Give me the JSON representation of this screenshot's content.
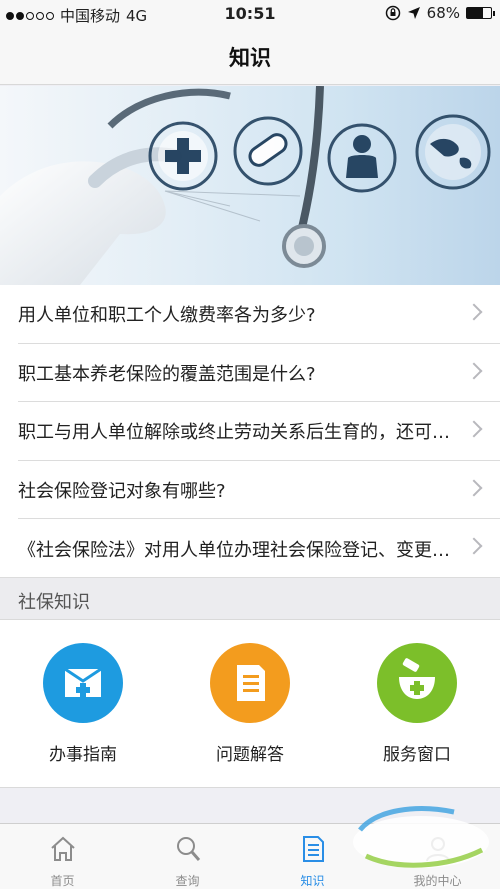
{
  "status_bar": {
    "carrier": "中国移动",
    "network": "4G",
    "time": "10:51",
    "battery": "68%",
    "battery_level": 0.68
  },
  "nav": {
    "title": "知识"
  },
  "faq": [
    {
      "text": "用人单位和职工个人缴费率各为多少?"
    },
    {
      "text": "职工基本养老保险的覆盖范围是什么?"
    },
    {
      "text": "职工与用人单位解除或终止劳动关系后生育的，还可以享受生育保险待遇吗?"
    },
    {
      "text": "社会保险登记对象有哪些?"
    },
    {
      "text": "《社会保险法》对用人单位办理社会保险登记、变更或注销登记是如何规定的?"
    }
  ],
  "section": {
    "title": "社保知识"
  },
  "services": [
    {
      "label": "办事指南",
      "icon": "envelope-plus-icon",
      "color": "#1e9be0"
    },
    {
      "label": "问题解答",
      "icon": "document-icon",
      "color": "#f39c1e"
    },
    {
      "label": "服务窗口",
      "icon": "mortar-plus-icon",
      "color": "#7cbf2a"
    }
  ],
  "tabs": [
    {
      "label": "首页",
      "icon": "home-icon",
      "active": false
    },
    {
      "label": "查询",
      "icon": "search-icon",
      "active": false
    },
    {
      "label": "知识",
      "icon": "document-icon",
      "active": true
    },
    {
      "label": "我的中心",
      "icon": "profile-icon",
      "active": false
    }
  ],
  "colors": {
    "accent": "#2a8ee6",
    "tab_inactive": "#8c8c8c"
  }
}
